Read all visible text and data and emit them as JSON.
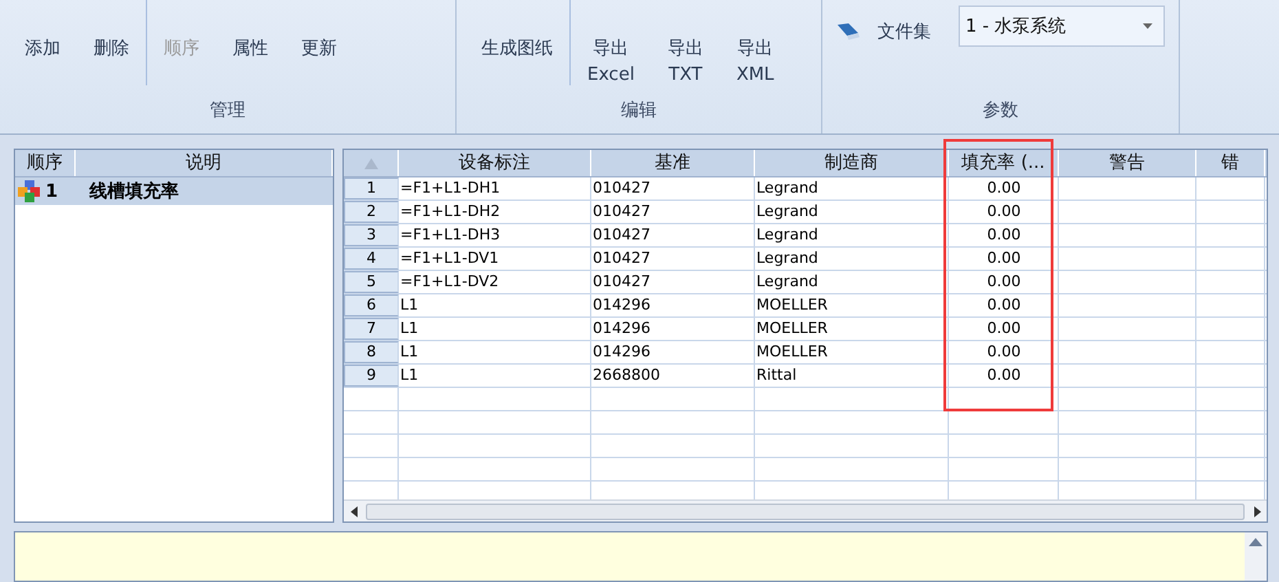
{
  "ribbon": {
    "groups": [
      {
        "label": "管理",
        "items": [
          {
            "kind": "button",
            "lines": [
              "添加"
            ],
            "disabled": false
          },
          {
            "kind": "button",
            "lines": [
              "删除"
            ],
            "disabled": false
          },
          {
            "kind": "separator"
          },
          {
            "kind": "button",
            "lines": [
              "顺序"
            ],
            "disabled": true
          },
          {
            "kind": "button",
            "lines": [
              "属性"
            ],
            "disabled": false
          },
          {
            "kind": "button",
            "lines": [
              "更新"
            ],
            "disabled": false
          }
        ]
      },
      {
        "label": "编辑",
        "items": [
          {
            "kind": "button",
            "lines": [
              "生成图纸"
            ],
            "disabled": false
          },
          {
            "kind": "separator"
          },
          {
            "kind": "button",
            "lines": [
              "导出",
              "Excel"
            ],
            "disabled": false
          },
          {
            "kind": "button",
            "lines": [
              "导出",
              "TXT"
            ],
            "disabled": false
          },
          {
            "kind": "button",
            "lines": [
              "导出",
              "XML"
            ],
            "disabled": false
          }
        ]
      }
    ],
    "params": {
      "label": "参数",
      "field_label": "文件集",
      "value": "1 - 水泵系统"
    }
  },
  "left_list": {
    "columns": [
      "顺序",
      "说明"
    ],
    "items": [
      {
        "order": "1",
        "text": "线槽填充率",
        "selected": true
      }
    ]
  },
  "grid": {
    "columns": [
      {
        "label": "设备标注",
        "highlighted": false
      },
      {
        "label": "基准",
        "highlighted": false
      },
      {
        "label": "制造商",
        "highlighted": false
      },
      {
        "label": "填充率 (...",
        "highlighted": true
      },
      {
        "label": "警告",
        "highlighted": false
      },
      {
        "label": "错",
        "highlighted": false
      }
    ],
    "rows": [
      {
        "num": "1",
        "cells": [
          "=F1+L1-DH1",
          "010427",
          "Legrand",
          "0.00",
          "",
          ""
        ]
      },
      {
        "num": "2",
        "cells": [
          "=F1+L1-DH2",
          "010427",
          "Legrand",
          "0.00",
          "",
          ""
        ]
      },
      {
        "num": "3",
        "cells": [
          "=F1+L1-DH3",
          "010427",
          "Legrand",
          "0.00",
          "",
          ""
        ]
      },
      {
        "num": "4",
        "cells": [
          "=F1+L1-DV1",
          "010427",
          "Legrand",
          "0.00",
          "",
          ""
        ]
      },
      {
        "num": "5",
        "cells": [
          "=F1+L1-DV2",
          "010427",
          "Legrand",
          "0.00",
          "",
          ""
        ]
      },
      {
        "num": "6",
        "cells": [
          "L1",
          "014296",
          "MOELLER",
          "0.00",
          "",
          ""
        ]
      },
      {
        "num": "7",
        "cells": [
          "L1",
          "014296",
          "MOELLER",
          "0.00",
          "",
          ""
        ]
      },
      {
        "num": "8",
        "cells": [
          "L1",
          "014296",
          "MOELLER",
          "0.00",
          "",
          ""
        ]
      },
      {
        "num": "9",
        "cells": [
          "L1",
          "2668800",
          "Rittal",
          "0.00",
          "",
          ""
        ]
      }
    ]
  }
}
